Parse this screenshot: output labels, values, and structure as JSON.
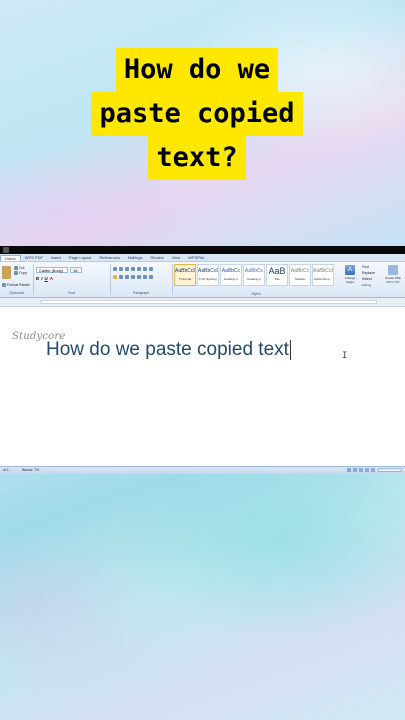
{
  "overlay": {
    "title_lines": [
      "How do we",
      "paste copied",
      "text?"
    ]
  },
  "word": {
    "tabs": [
      "Home",
      "WPS PDF",
      "Insert",
      "Page Layout",
      "References",
      "Mailings",
      "Review",
      "View",
      "WPSPlot"
    ],
    "clipboard": {
      "cut": "Cut",
      "copy": "Copy",
      "format_painter": "Format Painter",
      "group_label": "Clipboard"
    },
    "font": {
      "name": "Calibri (Body)",
      "size": "16",
      "group_label": "Font"
    },
    "paragraph_label": "Paragraph",
    "styles": {
      "tiles": [
        {
          "sample": "AaBbCcDd",
          "name": "¶ Normal"
        },
        {
          "sample": "AaBbCcDd",
          "name": "¶ No Spacing"
        },
        {
          "sample": "AaBbCc",
          "name": "Heading 1"
        },
        {
          "sample": "AaBbCc",
          "name": "Heading 2"
        },
        {
          "sample": "AaB",
          "name": "Title"
        },
        {
          "sample": "AaBbCc",
          "name": "Subtitle"
        },
        {
          "sample": "AaBbCcDd",
          "name": "Subtle Emp..."
        }
      ],
      "change_styles": "Change Styles",
      "group_label": "Styles"
    },
    "editing": {
      "find": "Find",
      "replace": "Replace",
      "select": "Select",
      "group_label": "Editing"
    },
    "right_group": {
      "button": "Create PDF",
      "label": "WPS PDF"
    },
    "document": {
      "signature": "Studycore",
      "body_text": "How do we paste copied text"
    },
    "status": {
      "page": "of 1",
      "words": "Words: 7/4"
    }
  }
}
